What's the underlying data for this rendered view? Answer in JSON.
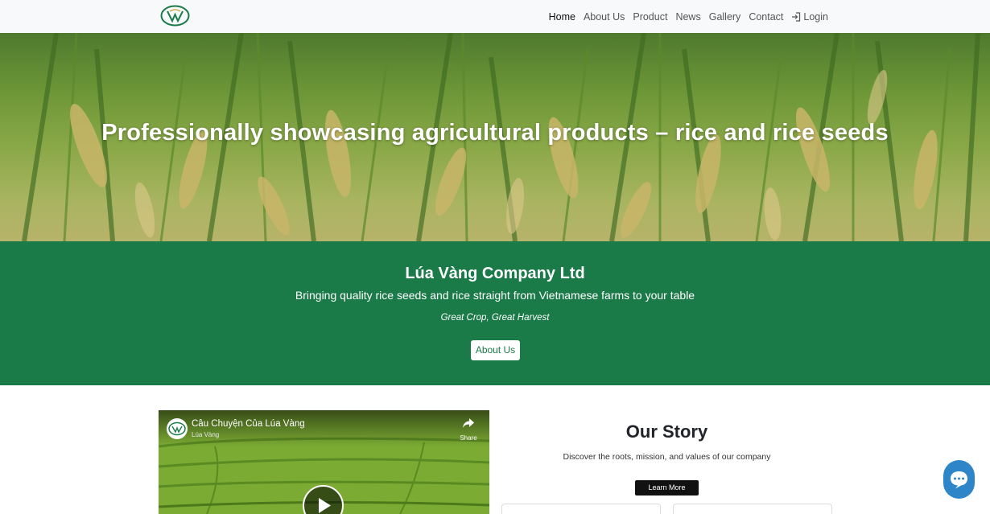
{
  "navbar": {
    "logo_text": "LV",
    "links": [
      {
        "label": "Home",
        "active": true
      },
      {
        "label": "About Us",
        "active": false
      },
      {
        "label": "Product",
        "active": false
      },
      {
        "label": "News",
        "active": false
      },
      {
        "label": "Gallery",
        "active": false
      },
      {
        "label": "Contact",
        "active": false
      }
    ],
    "login_label": "Login",
    "login_icon": "sign-in-icon"
  },
  "hero": {
    "title": "Professionally showcasing agricultural products – rice and rice seeds"
  },
  "intro": {
    "title": "Lúa Vàng Company Ltd",
    "subtitle": "Bringing quality rice seeds and rice straight from Vietnamese farms to your table",
    "slogan": "Great Crop, Great Harvest",
    "button_label": "About Us"
  },
  "video": {
    "title": "Câu Chuyện Của Lúa Vàng",
    "channel": "Lúa Vàng",
    "share_label": "Share",
    "play_icon": "play-icon"
  },
  "story": {
    "title": "Our Story",
    "description": "Discover the roots, mission, and values of our company",
    "button_label": "Learn More"
  },
  "colors": {
    "brand_green": "#1a7a48",
    "navbar_bg": "#f8f9fa",
    "chat_blue": "#2e86c8"
  }
}
